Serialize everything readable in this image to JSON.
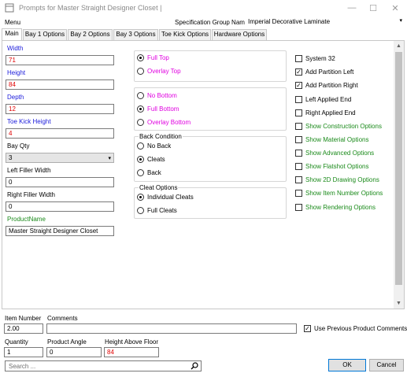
{
  "window": {
    "title": "Prompts for Master Straight Designer Closet |",
    "minimize_glyph": "—",
    "maximize_glyph": "☐",
    "close_glyph": "✕"
  },
  "menu": {
    "label": "Menu"
  },
  "spec": {
    "label": "Specification Group Name",
    "value": "Imperial Decorative Laminate"
  },
  "tabs": [
    {
      "label": "Main",
      "active": true
    },
    {
      "label": "Bay 1 Options"
    },
    {
      "label": "Bay 2 Options"
    },
    {
      "label": "Bay 3 Options"
    },
    {
      "label": "Toe Kick Options"
    },
    {
      "label": "Hardware Options"
    }
  ],
  "fields": {
    "width": {
      "label": "Width",
      "value": "71"
    },
    "height": {
      "label": "Height",
      "value": "84"
    },
    "depth": {
      "label": "Depth",
      "value": "12"
    },
    "toe_kick_height": {
      "label": "Toe Kick Height",
      "value": "4"
    },
    "bay_qty": {
      "label": "Bay Qty",
      "value": "3"
    },
    "left_filler": {
      "label": "Left Filler Width",
      "value": "0"
    },
    "right_filler": {
      "label": "Right Filler Width",
      "value": "0"
    },
    "product_name": {
      "label": "ProductName",
      "value": "Master Straight Designer Closet"
    }
  },
  "top_group": {
    "options": [
      "Full Top",
      "Overlay Top"
    ],
    "selected": 0
  },
  "bottom_group": {
    "options": [
      "No Bottom",
      "Full Bottom",
      "Overlay Bottom"
    ],
    "selected": 1
  },
  "back_condition": {
    "label": "Back Condition",
    "options": [
      "No Back",
      "Cleats",
      "Back"
    ],
    "selected": 1
  },
  "cleat_options": {
    "label": "Cleat Options",
    "options": [
      "Individual Cleats",
      "Full Cleats"
    ],
    "selected": 0
  },
  "checkboxes": [
    {
      "label": "System 32",
      "checked": false
    },
    {
      "label": "Add Partition Left",
      "checked": true
    },
    {
      "label": "Add Partition Right",
      "checked": true
    },
    {
      "label": "Left Applied End",
      "checked": false
    },
    {
      "label": "Right Applied End",
      "checked": false
    },
    {
      "label": "Show Construction Options",
      "checked": false
    },
    {
      "label": "Show Material Options",
      "checked": false
    },
    {
      "label": "Show Advanced Options",
      "checked": false
    },
    {
      "label": "Show Flatshot Options",
      "checked": false
    },
    {
      "label": "Show 2D Drawing Options",
      "checked": false
    },
    {
      "label": "Show Item Number Options",
      "checked": false
    },
    {
      "label": "Show Rendering Options",
      "checked": false
    }
  ],
  "scrollbar": {
    "up_glyph": "▲",
    "down_glyph": "▼",
    "thumb_fraction": 0.9
  },
  "footer": {
    "item_number": {
      "label": "Item Number",
      "value": "2.00"
    },
    "comments": {
      "label": "Comments",
      "value": ""
    },
    "use_previous_comments": {
      "label": "Use Previous Product Comments",
      "checked": true
    },
    "quantity": {
      "label": "Quantity",
      "value": "1"
    },
    "product_angle": {
      "label": "Product Angle",
      "value": "0"
    },
    "height_above_floor": {
      "label": "Height Above Floor",
      "value": "84"
    },
    "search_placeholder": "Search ...",
    "ok_label": "OK",
    "cancel_label": "Cancel"
  },
  "colors": {
    "label_blue": "#1a1adb",
    "label_green": "#1a8a1a",
    "option_magenta": "#e000e0",
    "value_red": "#e00000"
  }
}
